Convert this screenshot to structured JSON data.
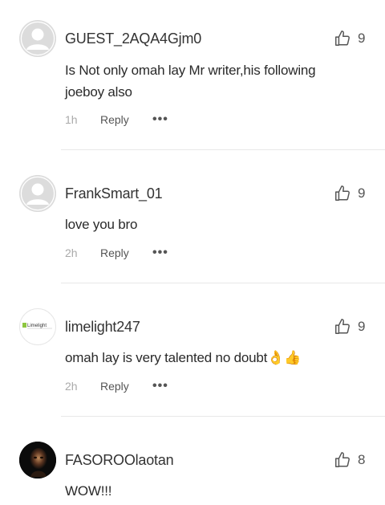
{
  "comments": [
    {
      "username": "GUEST_2AQA4Gjm0",
      "text_line1": "Is Not only omah lay Mr writer,his following",
      "text_line2": "joeboy also",
      "time": "1h",
      "likes": "9",
      "avatar": "default-avatar-icon"
    },
    {
      "username": "FrankSmart_01",
      "text": "love you bro",
      "time": "2h",
      "likes": "9",
      "avatar": "default-avatar-icon"
    },
    {
      "username": "limelight247",
      "text": "omah lay is very talented no doubt👌👍",
      "time": "2h",
      "likes": "9",
      "avatar": "limelight-logo",
      "avatar_logo_text": "Limelight"
    },
    {
      "username": "FASOROOlaotan",
      "text": "WOW!!!",
      "likes": "8",
      "avatar": "user-photo"
    }
  ],
  "labels": {
    "reply": "Reply",
    "more": "•••"
  },
  "colors": {
    "logo_green": "#8dc63f",
    "muted_text": "#aaaaaa",
    "divider": "#e8e8e8"
  }
}
